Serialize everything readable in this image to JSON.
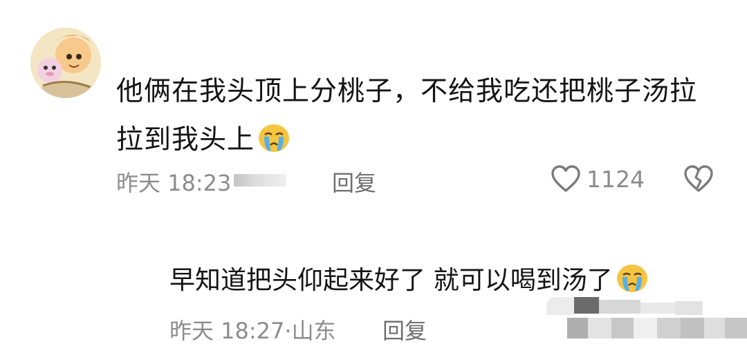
{
  "comment": {
    "text": "他俩在我头顶上分桃子，不给我吃还把桃子汤拉拉到我头上",
    "emoji_icon": "crying-face-icon",
    "time": "昨天 18:23",
    "reply_label": "回复",
    "like_count": "1124"
  },
  "reply": {
    "text": "早知道把头仰起来好了 就可以喝到汤了",
    "emoji_icon": "crying-face-icon",
    "time": "昨天 18:27·山东",
    "reply_label": "回复"
  },
  "colors": {
    "meta_text": "#8c8c8c",
    "body_text": "#141414"
  }
}
